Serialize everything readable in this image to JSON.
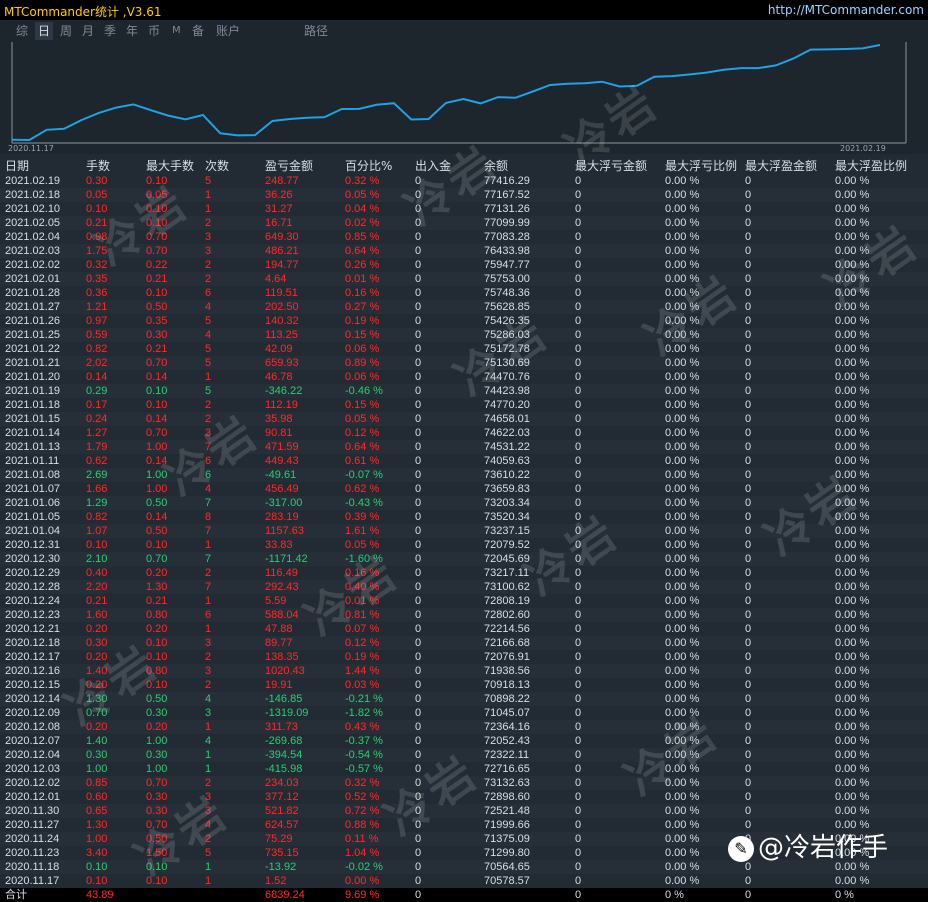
{
  "app": {
    "title": "MTCommander统计 ,V3.61",
    "site": "http://MTCommander.com"
  },
  "tabs": [
    "综",
    "日",
    "周",
    "月",
    "季",
    "年",
    "币",
    "M",
    "备",
    "账户",
    "路径"
  ],
  "active_tab": 1,
  "chart": {
    "start_label": "2020.11.17",
    "end_label": "2021.02.19",
    "line_color": "#1fa2e6"
  },
  "table": {
    "headers": [
      "日期",
      "手数",
      "最大手数",
      "次数",
      "盈亏金额",
      "百分比%",
      "出入金",
      "余额",
      "最大浮亏金额",
      "最大浮亏比例",
      "最大浮盈金额",
      "最大浮盈比例"
    ],
    "rows": [
      [
        "2021.02.19",
        "0.30",
        "0.10",
        "5",
        "248.77",
        "0.32 %",
        "0",
        "77416.29",
        "0",
        "0.00 %",
        "0",
        "0.00 %"
      ],
      [
        "2021.02.18",
        "0.05",
        "0.05",
        "1",
        "36.26",
        "0.05 %",
        "0",
        "77167.52",
        "0",
        "0.00 %",
        "0",
        "0.00 %"
      ],
      [
        "2021.02.10",
        "0.10",
        "0.10",
        "1",
        "31.27",
        "0.04 %",
        "0",
        "77131.26",
        "0",
        "0.00 %",
        "0",
        "0.00 %"
      ],
      [
        "2021.02.05",
        "0.21",
        "0.10",
        "2",
        "16.71",
        "0.02 %",
        "0",
        "77099.99",
        "0",
        "0.00 %",
        "0",
        "0.00 %"
      ],
      [
        "2021.02.04",
        "0.98",
        "0.70",
        "3",
        "649.30",
        "0.85 %",
        "0",
        "77083.28",
        "0",
        "0.00 %",
        "0",
        "0.00 %"
      ],
      [
        "2021.02.03",
        "1.75",
        "0.70",
        "3",
        "486.21",
        "0.64 %",
        "0",
        "76433.98",
        "0",
        "0.00 %",
        "0",
        "0.00 %"
      ],
      [
        "2021.02.02",
        "0.32",
        "0.22",
        "2",
        "194.77",
        "0.26 %",
        "0",
        "75947.77",
        "0",
        "0.00 %",
        "0",
        "0.00 %"
      ],
      [
        "2021.02.01",
        "0.35",
        "0.21",
        "2",
        "4.64",
        "0.01 %",
        "0",
        "75753.00",
        "0",
        "0.00 %",
        "0",
        "0.00 %"
      ],
      [
        "2021.01.28",
        "0.36",
        "0.10",
        "6",
        "119.51",
        "0.16 %",
        "0",
        "75748.36",
        "0",
        "0.00 %",
        "0",
        "0.00 %"
      ],
      [
        "2021.01.27",
        "1.21",
        "0.50",
        "4",
        "202.50",
        "0.27 %",
        "0",
        "75628.85",
        "0",
        "0.00 %",
        "0",
        "0.00 %"
      ],
      [
        "2021.01.26",
        "0.97",
        "0.35",
        "5",
        "140.32",
        "0.19 %",
        "0",
        "75426.35",
        "0",
        "0.00 %",
        "0",
        "0.00 %"
      ],
      [
        "2021.01.25",
        "0.59",
        "0.30",
        "4",
        "113.25",
        "0.15 %",
        "0",
        "75286.03",
        "0",
        "0.00 %",
        "0",
        "0.00 %"
      ],
      [
        "2021.01.22",
        "0.82",
        "0.21",
        "5",
        "42.09",
        "0.06 %",
        "0",
        "75172.78",
        "0",
        "0.00 %",
        "0",
        "0.00 %"
      ],
      [
        "2021.01.21",
        "2.02",
        "0.70",
        "5",
        "659.93",
        "0.89 %",
        "0",
        "75130.69",
        "0",
        "0.00 %",
        "0",
        "0.00 %"
      ],
      [
        "2021.01.20",
        "0.14",
        "0.14",
        "1",
        "46.78",
        "0.06 %",
        "0",
        "74470.76",
        "0",
        "0.00 %",
        "0",
        "0.00 %"
      ],
      [
        "2021.01.19",
        "0.29",
        "0.10",
        "5",
        "-346.22",
        "-0.46 %",
        "0",
        "74423.98",
        "0",
        "0.00 %",
        "0",
        "0.00 %"
      ],
      [
        "2021.01.18",
        "0.17",
        "0.10",
        "2",
        "112.19",
        "0.15 %",
        "0",
        "74770.20",
        "0",
        "0.00 %",
        "0",
        "0.00 %"
      ],
      [
        "2021.01.15",
        "0.24",
        "0.14",
        "2",
        "35.98",
        "0.05 %",
        "0",
        "74658.01",
        "0",
        "0.00 %",
        "0",
        "0.00 %"
      ],
      [
        "2021.01.14",
        "1.27",
        "0.70",
        "3",
        "90.81",
        "0.12 %",
        "0",
        "74622.03",
        "0",
        "0.00 %",
        "0",
        "0.00 %"
      ],
      [
        "2021.01.13",
        "1.79",
        "1.00",
        "7",
        "471.59",
        "0.64 %",
        "0",
        "74531.22",
        "0",
        "0.00 %",
        "0",
        "0.00 %"
      ],
      [
        "2021.01.11",
        "0.62",
        "0.14",
        "6",
        "449.43",
        "0.61 %",
        "0",
        "74059.63",
        "0",
        "0.00 %",
        "0",
        "0.00 %"
      ],
      [
        "2021.01.08",
        "2.69",
        "1.00",
        "6",
        "-49.61",
        "-0.07 %",
        "0",
        "73610.22",
        "0",
        "0.00 %",
        "0",
        "0.00 %"
      ],
      [
        "2021.01.07",
        "1.66",
        "1.00",
        "4",
        "456.49",
        "0.62 %",
        "0",
        "73659.83",
        "0",
        "0.00 %",
        "0",
        "0.00 %"
      ],
      [
        "2021.01.06",
        "1.29",
        "0.50",
        "7",
        "-317.00",
        "-0.43 %",
        "0",
        "73203.34",
        "0",
        "0.00 %",
        "0",
        "0.00 %"
      ],
      [
        "2021.01.05",
        "0.82",
        "0.14",
        "8",
        "283.19",
        "0.39 %",
        "0",
        "73520.34",
        "0",
        "0.00 %",
        "0",
        "0.00 %"
      ],
      [
        "2021.01.04",
        "1.07",
        "0.50",
        "7",
        "1157.63",
        "1.61 %",
        "0",
        "73237.15",
        "0",
        "0.00 %",
        "0",
        "0.00 %"
      ],
      [
        "2020.12.31",
        "0.10",
        "0.10",
        "1",
        "33.83",
        "0.05 %",
        "0",
        "72079.52",
        "0",
        "0.00 %",
        "0",
        "0.00 %"
      ],
      [
        "2020.12.30",
        "2.10",
        "0.70",
        "7",
        "-1171.42",
        "-1.60 %",
        "0",
        "72045.69",
        "0",
        "0.00 %",
        "0",
        "0.00 %"
      ],
      [
        "2020.12.29",
        "0.40",
        "0.20",
        "2",
        "116.49",
        "0.16 %",
        "0",
        "73217.11",
        "0",
        "0.00 %",
        "0",
        "0.00 %"
      ],
      [
        "2020.12.28",
        "2.20",
        "1.30",
        "7",
        "292.43",
        "0.40 %",
        "0",
        "73100.62",
        "0",
        "0.00 %",
        "0",
        "0.00 %"
      ],
      [
        "2020.12.24",
        "0.21",
        "0.21",
        "1",
        "5.59",
        "0.01 %",
        "0",
        "72808.19",
        "0",
        "0.00 %",
        "0",
        "0.00 %"
      ],
      [
        "2020.12.23",
        "1.60",
        "0.80",
        "6",
        "588.04",
        "0.81 %",
        "0",
        "72802.60",
        "0",
        "0.00 %",
        "0",
        "0.00 %"
      ],
      [
        "2020.12.21",
        "0.20",
        "0.20",
        "1",
        "47.88",
        "0.07 %",
        "0",
        "72214.56",
        "0",
        "0.00 %",
        "0",
        "0.00 %"
      ],
      [
        "2020.12.18",
        "0.30",
        "0.10",
        "3",
        "89.77",
        "0.12 %",
        "0",
        "72166.68",
        "0",
        "0.00 %",
        "0",
        "0.00 %"
      ],
      [
        "2020.12.17",
        "0.20",
        "0.10",
        "2",
        "138.35",
        "0.19 %",
        "0",
        "72076.91",
        "0",
        "0.00 %",
        "0",
        "0.00 %"
      ],
      [
        "2020.12.16",
        "1.40",
        "0.80",
        "3",
        "1020.43",
        "1.44 %",
        "0",
        "71938.56",
        "0",
        "0.00 %",
        "0",
        "0.00 %"
      ],
      [
        "2020.12.15",
        "0.20",
        "0.10",
        "2",
        "19.91",
        "0.03 %",
        "0",
        "70918.13",
        "0",
        "0.00 %",
        "0",
        "0.00 %"
      ],
      [
        "2020.12.14",
        "1.30",
        "0.50",
        "4",
        "-146.85",
        "-0.21 %",
        "0",
        "70898.22",
        "0",
        "0.00 %",
        "0",
        "0.00 %"
      ],
      [
        "2020.12.09",
        "0.70",
        "0.30",
        "3",
        "-1319.09",
        "-1.82 %",
        "0",
        "71045.07",
        "0",
        "0.00 %",
        "0",
        "0.00 %"
      ],
      [
        "2020.12.08",
        "0.20",
        "0.20",
        "1",
        "311.73",
        "0.43 %",
        "0",
        "72364.16",
        "0",
        "0.00 %",
        "0",
        "0.00 %"
      ],
      [
        "2020.12.07",
        "1.40",
        "1.00",
        "4",
        "-269.68",
        "-0.37 %",
        "0",
        "72052.43",
        "0",
        "0.00 %",
        "0",
        "0.00 %"
      ],
      [
        "2020.12.04",
        "0.30",
        "0.30",
        "1",
        "-394.54",
        "-0.54 %",
        "0",
        "72322.11",
        "0",
        "0.00 %",
        "0",
        "0.00 %"
      ],
      [
        "2020.12.03",
        "1.00",
        "1.00",
        "1",
        "-415.98",
        "-0.57 %",
        "0",
        "72716.65",
        "0",
        "0.00 %",
        "0",
        "0.00 %"
      ],
      [
        "2020.12.02",
        "0.85",
        "0.70",
        "2",
        "234.03",
        "0.32 %",
        "0",
        "73132.63",
        "0",
        "0.00 %",
        "0",
        "0.00 %"
      ],
      [
        "2020.12.01",
        "0.60",
        "0.30",
        "3",
        "377.12",
        "0.52 %",
        "0",
        "72898.60",
        "0",
        "0.00 %",
        "0",
        "0.00 %"
      ],
      [
        "2020.11.30",
        "0.65",
        "0.30",
        "3",
        "521.82",
        "0.72 %",
        "0",
        "72521.48",
        "0",
        "0.00 %",
        "0",
        "0.00 %"
      ],
      [
        "2020.11.27",
        "1.30",
        "0.70",
        "4",
        "624.57",
        "0.88 %",
        "0",
        "71999.66",
        "0",
        "0.00 %",
        "0",
        "0.00 %"
      ],
      [
        "2020.11.24",
        "1.00",
        "0.50",
        "2",
        "75.29",
        "0.11 %",
        "0",
        "71375.09",
        "0",
        "0.00 %",
        "0",
        "0.00 %"
      ],
      [
        "2020.11.23",
        "3.40",
        "1.50",
        "5",
        "735.15",
        "1.04 %",
        "0",
        "71299.80",
        "0",
        "0.00 %",
        "0",
        "0.00 %"
      ],
      [
        "2020.11.18",
        "0.10",
        "0.10",
        "1",
        "-13.92",
        "-0.02 %",
        "0",
        "70564.65",
        "0",
        "0.00 %",
        "0",
        "0.00 %"
      ],
      [
        "2020.11.17",
        "0.10",
        "0.10",
        "1",
        "1.52",
        "0.00 %",
        "0",
        "70578.57",
        "0",
        "0.00 %",
        "0",
        "0.00 %"
      ]
    ],
    "total": [
      "合计",
      "43.89",
      "",
      "",
      "6839.24",
      "9.69 %",
      "0",
      "",
      "0",
      "0 %",
      "0",
      "0 %"
    ]
  },
  "watermark": "冷岩",
  "brand": {
    "icon": "头条",
    "text": "@冷岩作手"
  }
}
